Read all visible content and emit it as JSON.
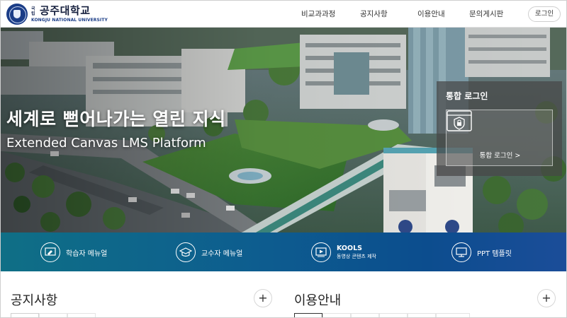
{
  "header": {
    "logo": {
      "small_text": "국립",
      "name": "공주대학교",
      "sub": "KONGJU NATIONAL UNIVERSITY"
    },
    "nav": [
      "비교과과정",
      "공지사항",
      "이용안내",
      "문의게시판"
    ],
    "login_label": "로그인"
  },
  "hero": {
    "title": "세계로 뻗어나가는 열린 지식",
    "subtitle": "Extended Canvas LMS Platform"
  },
  "login_panel": {
    "title": "통합 로그인",
    "link_label": "통합 로그인 >"
  },
  "quick_links": [
    {
      "label": "학습자 메뉴얼",
      "icon": "learner-manual-icon"
    },
    {
      "label": "교수자 메뉴얼",
      "icon": "graduation-cap-icon"
    },
    {
      "label": "KOOLS",
      "sub": "동영상 콘텐츠 제작",
      "icon": "video-player-icon"
    },
    {
      "label": "PPT 템플릿",
      "icon": "monitor-icon"
    }
  ],
  "sections": {
    "notice_title": "공지사항",
    "guide_title": "이용안내",
    "plus": "+"
  },
  "colors": {
    "brand_navy": "#1b3d87",
    "quickbar_start": "#0f6f86",
    "quickbar_end": "#1b4d99"
  }
}
